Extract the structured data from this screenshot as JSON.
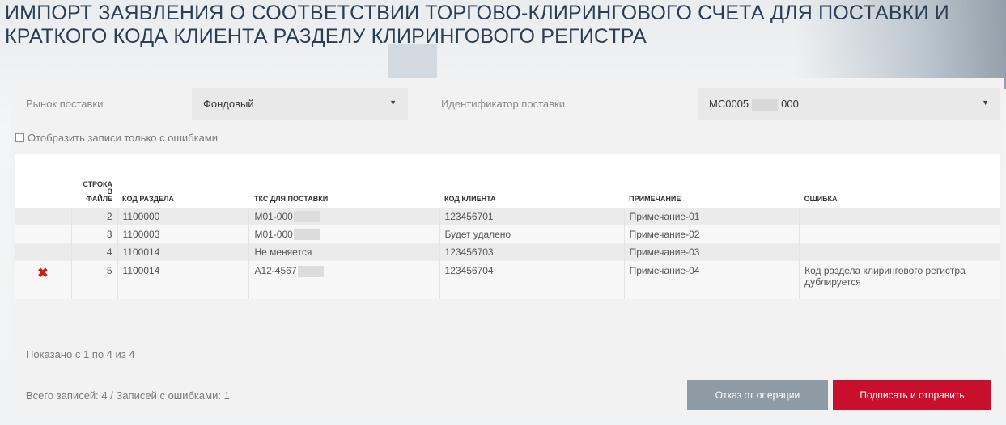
{
  "page": {
    "title": "ИМПОРТ ЗАЯВЛЕНИЯ О СООТВЕТСТВИИ ТОРГОВО-КЛИРИНГОВОГО СЧЕТА ДЛЯ ПОСТАВКИ И КРАТКОГО КОДА КЛИЕНТА РАЗДЕЛУ КЛИРИНГОВОГО РЕГИСТРА"
  },
  "filters": {
    "market_label": "Рынок поставки",
    "market_value": "Фондовый",
    "delivery_id_label": "Идентификатор поставки",
    "delivery_id_prefix": "MC0005",
    "delivery_id_suffix": "000",
    "errors_only_label": "Отобразить записи только с ошибками"
  },
  "table": {
    "columns": [
      "СТРОКА В ФАЙЛЕ",
      "КОД РАЗДЕЛА",
      "ТКС ДЛЯ ПОСТАВКИ",
      "КОД КЛИЕНТА",
      "ПРИМЕЧАНИЕ",
      "ОШИБКА"
    ],
    "col_line": [
      "СТРОКА",
      "В",
      "ФАЙЛЕ"
    ],
    "rows": [
      {
        "line": "2",
        "section": "1100000",
        "tks": "M01-000",
        "client": "123456701",
        "note": "Примечание-01",
        "error": ""
      },
      {
        "line": "3",
        "section": "1100003",
        "tks": "M01-000",
        "client": "Будет удалено",
        "note": "Примечание-02",
        "error": ""
      },
      {
        "line": "4",
        "section": "1100014",
        "tks": "Не меняется",
        "client": "123456703",
        "note": "Примечание-03",
        "error": ""
      },
      {
        "line": "5",
        "section": "1100014",
        "tks": "A12-4567",
        "client": "123456704",
        "note": "Примечание-04",
        "error": "Код раздела клирингового регистра дублируется",
        "error_icon": "close-icon"
      }
    ]
  },
  "footer": {
    "shown": "Показано с 1 по 4 из 4",
    "totals": "Всего записей: 4 / Записей с ошибками: 1",
    "cancel_label": "Отказ от операции",
    "submit_label": "Подписать и отправить"
  },
  "colors": {
    "accent": "#c8102e",
    "cancel_button": "#8e9ba4",
    "error_icon": "#c0221a"
  }
}
